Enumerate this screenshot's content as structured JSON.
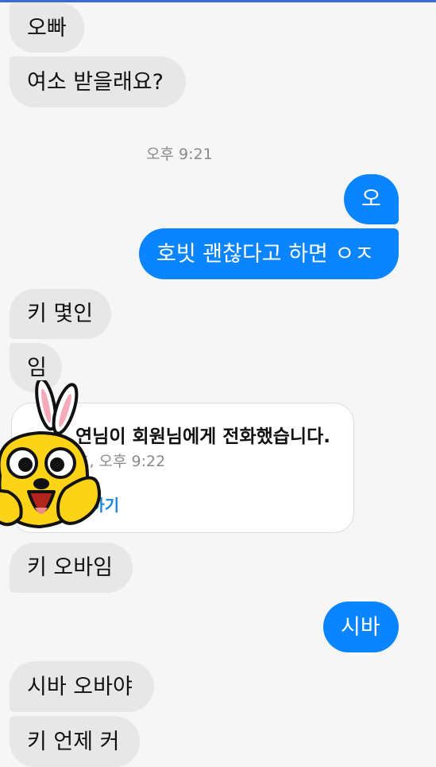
{
  "messages": [
    {
      "text": "오빠"
    },
    {
      "text": "여소 받을래요?"
    },
    {
      "text": "오"
    },
    {
      "text": "호빗 괜찮다고 하면 ㅇㅈ"
    },
    {
      "text": "키 몇인"
    },
    {
      "text": "임"
    },
    {
      "text": "키 오바임"
    },
    {
      "text": "시바"
    },
    {
      "text": "시바 오바야"
    },
    {
      "text": "키 언제 커"
    }
  ],
  "timestamp": "오후 9:21",
  "call_card": {
    "text": "연님이 회원님에게 전화했습니다.",
    "sub": "초, 오후 9:22",
    "link": "하하기"
  },
  "sticker": {
    "icon": "rabbit-sticker-icon"
  },
  "colors": {
    "outgoing": "#0a84ff",
    "incoming": "#e7e7e8",
    "link": "#1a88e0"
  }
}
